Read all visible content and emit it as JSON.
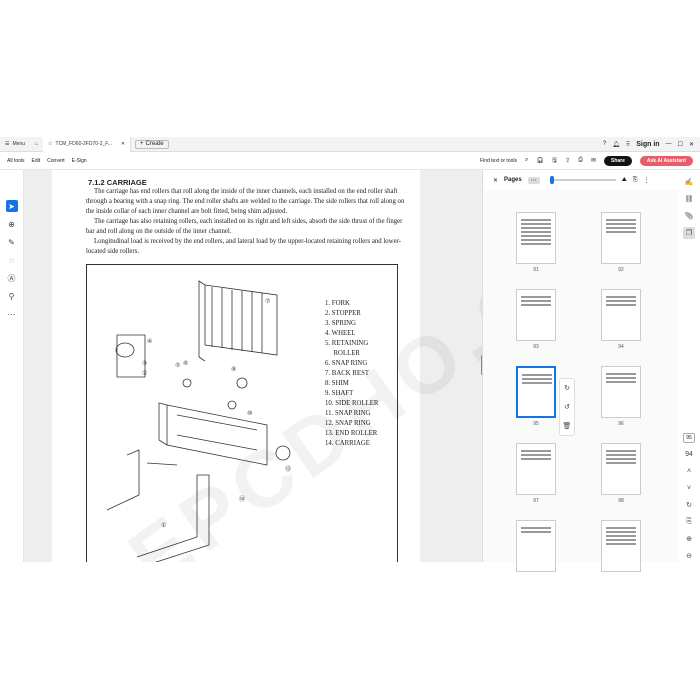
{
  "tabbar": {
    "menu_label": "Menu",
    "doc_tab": "TCM_FD60-2FD70-2_F...",
    "create_label": "Create",
    "signin": "Sign in"
  },
  "toolbar": {
    "all_tools": "All tools",
    "edit": "Edit",
    "convert": "Convert",
    "esign": "E-Sign",
    "find": "Find text or tools",
    "share": "Share",
    "ai": "Ask AI Assistant"
  },
  "document": {
    "section_title": "7.1.2  CARRIAGE",
    "para1": "The carriage has end rollers that roll along the inside of the inner channels, each installed on the end roller shaft through a bearing with a snap ring. The end roller shafts are welded to the carriage. The side rollers that roll along on the inside collar of each inner channel are bolt fitted, being shim adjusted.",
    "para2": "The carriage has also retaining rollers, each installed on its right and left sides, absorb the side thrust of the finger bar and roll along on the outside of the inner channel.",
    "para3": "Longitudinal load is received by the end rollers, and lateral load by the upper-located retaining rollers and lower-located side rollers.",
    "parts": [
      "1.  FORK",
      "2.  STOPPER",
      "3.  SPRING",
      "4.  WHEEL",
      "5.  RETAINING",
      "     ROLLER",
      "6.  SNAP RING",
      "7.  BACK REST",
      "8.  SHIM",
      "9.  SHAFT",
      "10. SIDE ROLLER",
      "11. SNAP RING",
      "12. SNAP RING",
      "13. END ROLLER",
      "14. CARRIAGE"
    ],
    "watermark": "EPCDHO.COM"
  },
  "panel": {
    "title": "Pages",
    "thumbs": [
      "91",
      "92",
      "93",
      "94",
      "95",
      "96",
      "97",
      "98"
    ],
    "selected": "95"
  },
  "rightrail": {
    "page_current": "95",
    "page_next": "94"
  }
}
